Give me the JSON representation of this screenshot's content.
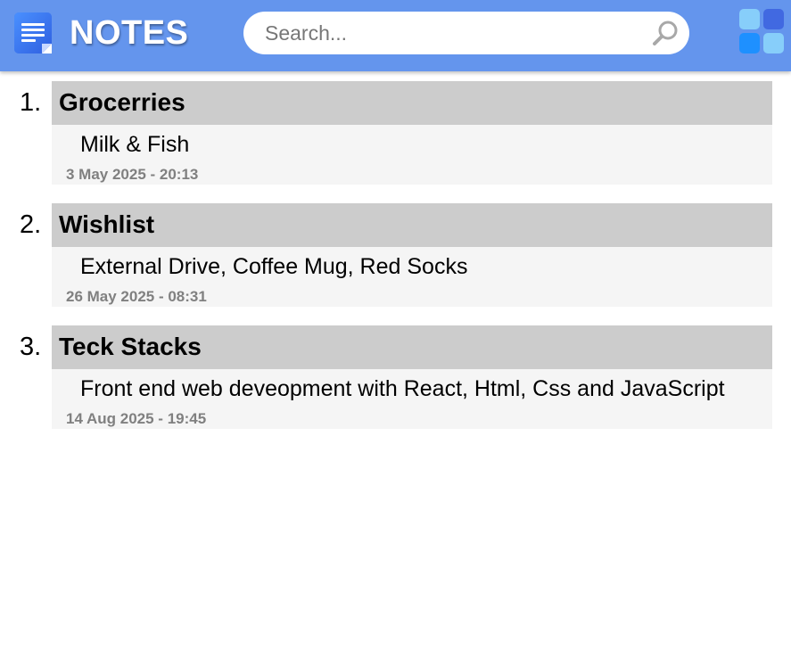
{
  "header": {
    "app_icon": "notepad-icon",
    "title": "NOTES",
    "search": {
      "placeholder": "Search...",
      "value": "",
      "icon": "search-icon"
    },
    "menu_icon": "grid-icon",
    "colors": {
      "bar": "#6495ed",
      "grid": [
        "#87cefa",
        "#4169e1",
        "#1e90ff",
        "#87cefa"
      ]
    }
  },
  "notes": [
    {
      "index": "1.",
      "title": "Grocerries",
      "content": "Milk & Fish",
      "date": "3 May 2025 - 20:13"
    },
    {
      "index": "2.",
      "title": "Wishlist",
      "content": "External Drive, Coffee Mug, Red Socks",
      "date": "26 May 2025 - 08:31"
    },
    {
      "index": "3.",
      "title": "Teck Stacks",
      "content": "Front end web deveopment with React, Html, Css and JavaScript",
      "date": "14 Aug 2025 - 19:45"
    }
  ]
}
